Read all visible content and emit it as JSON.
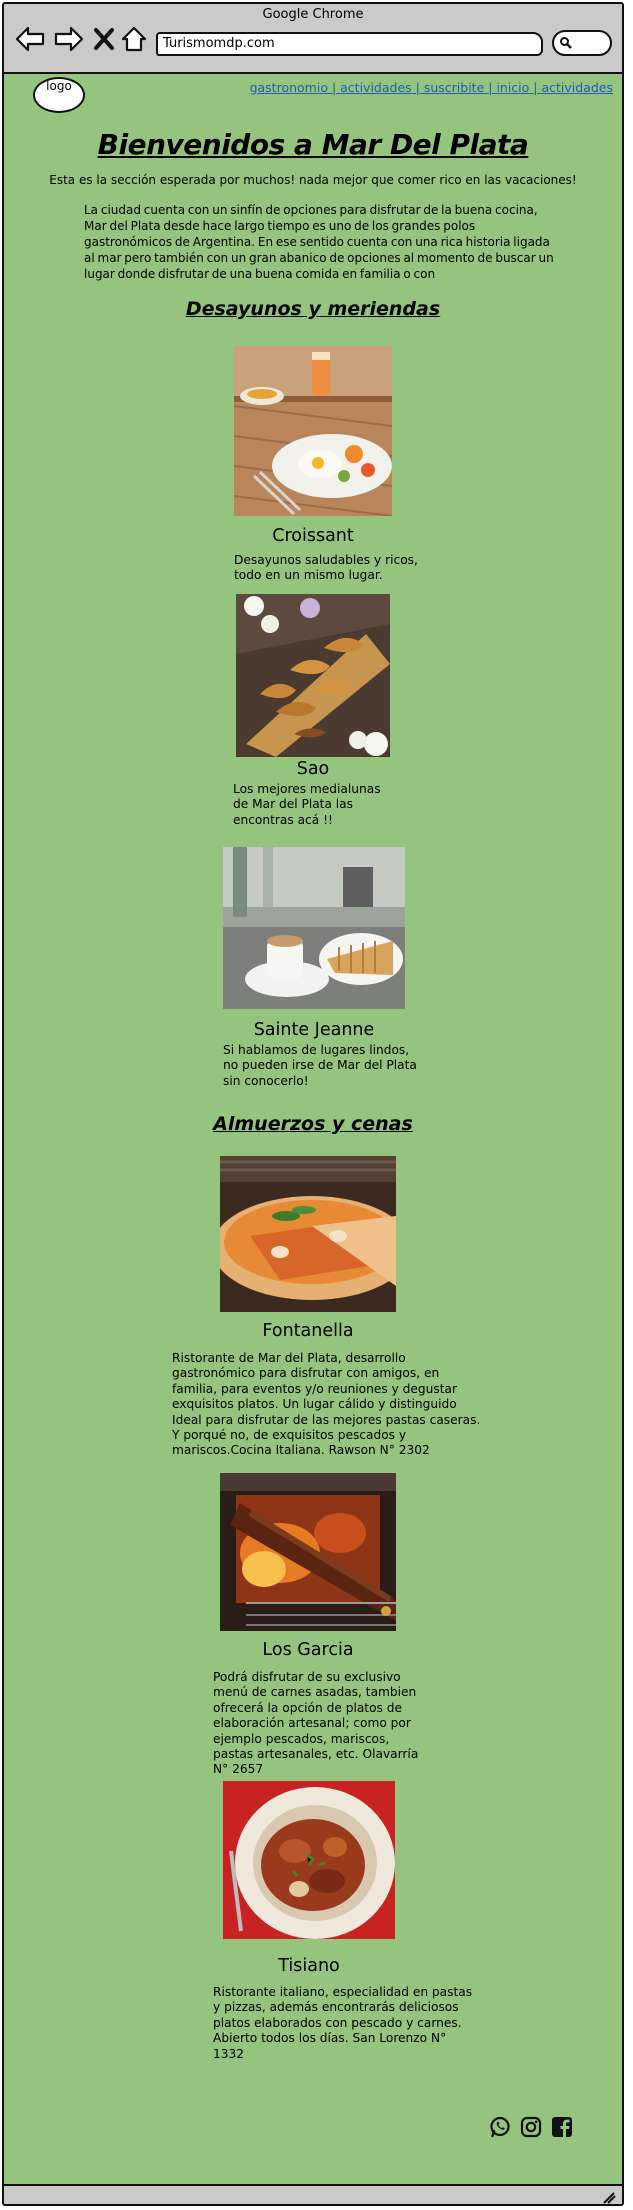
{
  "browser": {
    "title": "Google Chrome",
    "url": "Turismomdp.com",
    "nav_icons": [
      "back-arrow-icon",
      "forward-arrow-icon",
      "close-x-icon",
      "home-icon"
    ],
    "search_icon": "search-icon"
  },
  "header": {
    "logo": "logo",
    "links": [
      "gastronomio",
      "actividades",
      "suscribite",
      "inicio",
      "actividades"
    ],
    "link_separator": " | ",
    "link_color": "#1c5fb5"
  },
  "main": {
    "title": "Bienvenidos a Mar Del Plata",
    "intro": "Esta es la sección esperada por muchos! nada mejor que comer rico en las vacaciones!",
    "description": "La ciudad cuenta con un sinfín de opciones para disfrutar de la buena cocina, Mar del Plata desde hace largo tiempo es uno de los grandes polos gastronómicos de Argentina. En ese sentido cuenta con una rica historia ligada al mar pero también con un gran abanico de opciones al momento de buscar un lugar donde disfrutar de una buena comida en familia o con"
  },
  "sections": [
    {
      "title": "Desayunos y meriendas",
      "places": [
        {
          "name": "Croissant",
          "description": "Desayunos saludables y ricos, todo en un mismo lugar.",
          "photo": "breakfast-table-photo"
        },
        {
          "name": "Sao",
          "description": "Los mejores medialunas de Mar del Plata las encontras acá !!",
          "photo": "croissants-board-photo"
        },
        {
          "name": "Sainte Jeanne",
          "description": "Si hablamos de lugares lindos, no pueden irse de Mar del Plata sin conocerlo!",
          "photo": "coffee-waffles-photo"
        }
      ]
    },
    {
      "title": "Almuerzos y cenas",
      "places": [
        {
          "name": "Fontanella",
          "description": "Ristorante de Mar del Plata, desarrollo gastronómico para disfrutar con amigos, en familia, para eventos y/o reuniones y degustar exquisitos platos. Un lugar cálido y distinguido Ideal para disfrutar de las mejores pastas caseras. Y porqué no, de exquisitos pescados y mariscos.Cocina Italiana. Rawson N° 2302",
          "photo": "pizza-photo"
        },
        {
          "name": "Los Garcia",
          "description": "Podrá disfrutar de su exclusivo menú de carnes asadas, tambien ofrecerá la opción de platos de elaboración artesanal; como por ejemplo pescados, mariscos, pastas artesanales, etc. Olavarría N° 2657",
          "photo": "grilled-ribs-photo"
        },
        {
          "name": "Tisiano",
          "description": "Ristorante italiano, especialidad en pastas y pizzas, además encontrarás deliciosos platos elaborados con pescado y carnes. Abierto todos los días. San Lorenzo N° 1332",
          "photo": "pasta-plate-photo"
        }
      ]
    }
  ],
  "footer": {
    "social_icons": [
      "whatsapp-icon",
      "instagram-icon",
      "facebook-icon"
    ]
  },
  "colors": {
    "page_background": "#94c47d",
    "chrome_gray": "#cacaca"
  }
}
